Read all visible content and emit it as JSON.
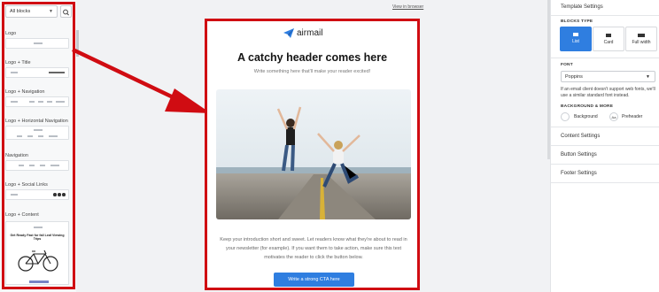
{
  "left_panel": {
    "select_value": "All blocks",
    "categories": [
      "Logo",
      "Logo + Title",
      "Logo + Navigation",
      "Logo + Horizontal Navigation",
      "Navigation",
      "Logo + Social Links",
      "Logo + Content"
    ],
    "content_card_title": "Get Ready Fast for fall Leaf Viewing Trips"
  },
  "email": {
    "view_in_browser": "View in browser",
    "logo_text": "airmail",
    "headline": "A catchy header comes here",
    "subheadline": "Write something here that'll make your reader excited!",
    "body": "Keep your introduction short and sweet. Let readers know what they're about to read in your newsletter (for example). If you want them to take action, make sure this text motivates the reader to click the button below.",
    "cta_label": "Write a strong CTA here"
  },
  "right_panel": {
    "title": "Template Settings",
    "blocks_type_label": "BLOCKS TYPE",
    "block_types": [
      "List",
      "Card",
      "Full width"
    ],
    "font_label": "FONT",
    "font_value": "Poppins",
    "font_note": "If an email client doesn't support web fonts, we'll use a similar standard font instead.",
    "bg_label": "BACKGROUND & MORE",
    "background_label": "Background",
    "preheader_swatch": "Aa",
    "preheader_label": "Preheader",
    "sections": [
      "Content Settings",
      "Button Settings",
      "Footer Settings"
    ]
  },
  "colors": {
    "accent": "#2f7ee0",
    "highlight": "#d00c12"
  }
}
